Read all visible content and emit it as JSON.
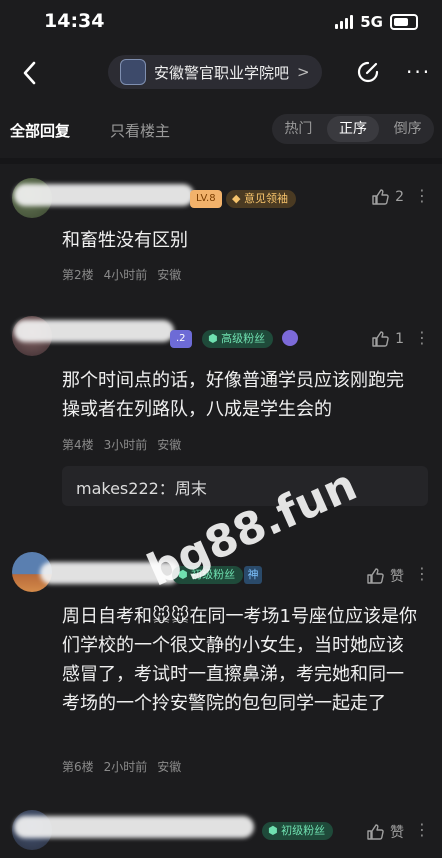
{
  "status_bar": {
    "time": "14:34",
    "network": "5G"
  },
  "nav": {
    "forum_name": "安徽警官职业学院吧",
    "arrow": ">"
  },
  "tabs": {
    "all_replies": "全部回复",
    "op_only": "只看楼主",
    "sort": [
      "热门",
      "正序",
      "倒序"
    ],
    "active_sort": "正序"
  },
  "posts": [
    {
      "level": "LV.8",
      "badge": "意见领袖",
      "likes": "2",
      "content": "和畜牲没有区别",
      "floor": "第2楼",
      "time": "4小时前",
      "location": "安徽"
    },
    {
      "level": ".2",
      "badge": "高级粉丝",
      "likes": "1",
      "content": "那个时间点的话，好像普通学员应该刚跑完操或者在列路队，八成是学生会的",
      "floor": "第4楼",
      "time": "3小时前",
      "location": "安徽",
      "reply": {
        "user": "makes222：",
        "text": "周末"
      }
    },
    {
      "badge": "初级粉丝",
      "tag": "神",
      "likes": "赞",
      "content": "周日自考和🐭🐭在同一考场1号座位应该是你们学校的一个很文静的小女生，当时她应该感冒了，考试时一直擦鼻涕，考完她和同一考场的一个拎安警院的包包同学一起走了",
      "floor": "第6楼",
      "time": "2小时前",
      "location": "安徽"
    },
    {
      "badge": "初级粉丝",
      "likes": "赞"
    }
  ],
  "watermark": "bg88.fun"
}
